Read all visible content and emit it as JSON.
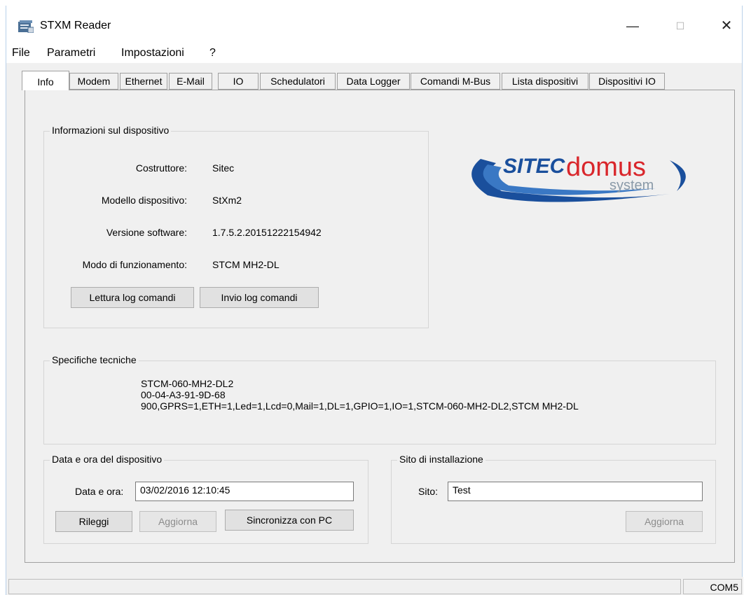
{
  "window": {
    "title": "STXM Reader",
    "controls": {
      "minimize": "—",
      "maximize": "☐",
      "close": "✕"
    }
  },
  "menu": [
    "File",
    "Parametri",
    "Impostazioni",
    "?"
  ],
  "tabs": [
    "Info",
    "Modem",
    "Ethernet",
    "E-Mail",
    "IO",
    "Schedulatori",
    "Data Logger",
    "Comandi M-Bus",
    "Lista dispositivi",
    "Dispositivi IO"
  ],
  "device_info": {
    "legend": "Informazioni sul dispositivo",
    "rows": [
      {
        "label": "Costruttore:",
        "value": "Sitec"
      },
      {
        "label": "Modello dispositivo:",
        "value": "StXm2"
      },
      {
        "label": "Versione software:",
        "value": "1.7.5.2.20151222154942"
      },
      {
        "label": "Modo di funzionamento:",
        "value": "STCM MH2-DL"
      }
    ],
    "read_log_button": "Lettura log comandi",
    "send_log_button": "Invio log comandi"
  },
  "logo": {
    "brand": "SITEC",
    "sub": "domus",
    "tag": "system",
    "colors": {
      "blue": "#1a4f9c",
      "red": "#d9262b",
      "gray": "#8a9aa8"
    }
  },
  "specs": {
    "legend": "Specifiche tecniche",
    "lines": [
      "STCM-060-MH2-DL2",
      "00-04-A3-91-9D-68",
      "900,GPRS=1,ETH=1,Led=1,Lcd=0,Mail=1,DL=1,GPIO=1,IO=1,STCM-060-MH2-DL2,STCM MH2-DL"
    ]
  },
  "datetime": {
    "legend": "Data e ora del dispositivo",
    "label": "Data e ora:",
    "value": "03/02/2016 12:10:45",
    "reload_button": "Rileggi",
    "update_button": "Aggiorna",
    "sync_button": "Sincronizza con PC"
  },
  "site": {
    "legend": "Sito di installazione",
    "label": "Sito:",
    "value": "Test",
    "update_button": "Aggiorna"
  },
  "status": {
    "port": "COM5"
  }
}
